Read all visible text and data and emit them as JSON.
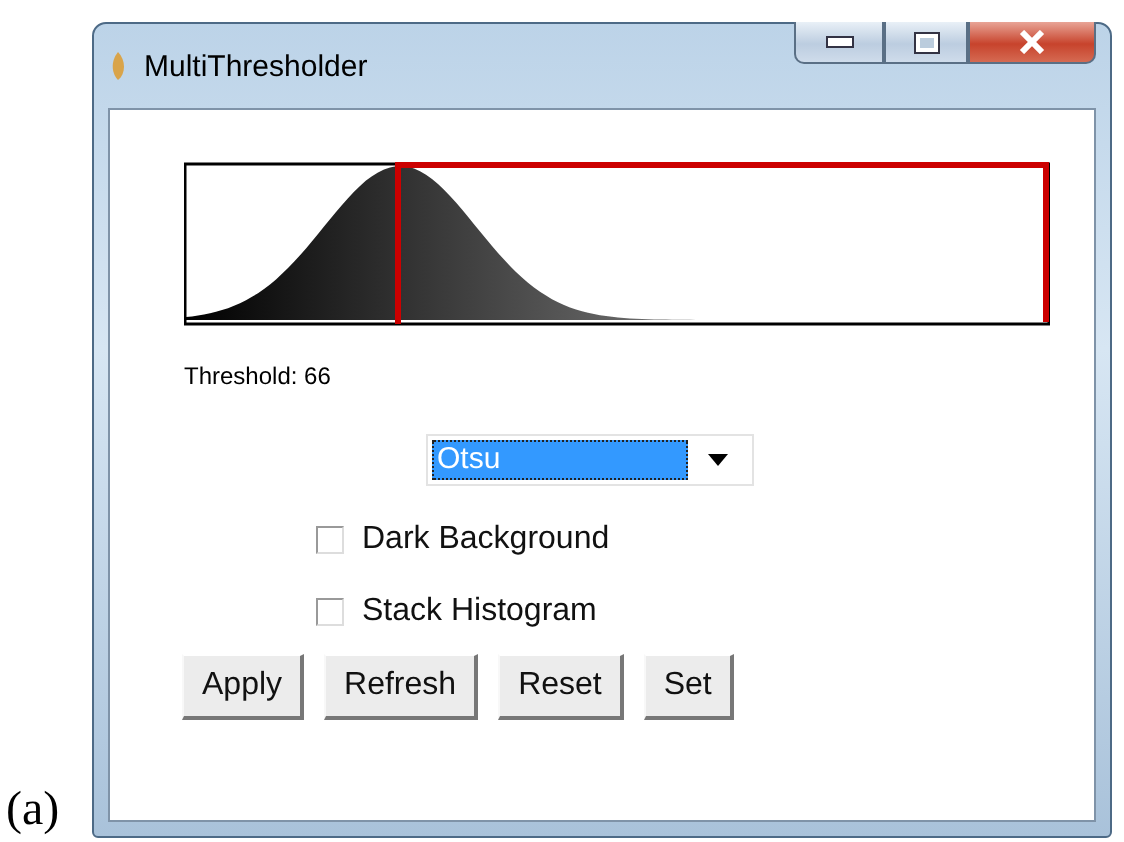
{
  "figure_label": "(a)",
  "window": {
    "title": "MultiThresholder"
  },
  "threshold_label": "Threshold: 66",
  "method": {
    "value": "Otsu",
    "focused": true
  },
  "checkboxes": [
    {
      "label": "Dark Background",
      "checked": false
    },
    {
      "label": "Stack Histogram",
      "checked": false
    }
  ],
  "buttons": [
    "Apply",
    "Refresh",
    "Reset",
    "Set"
  ]
}
